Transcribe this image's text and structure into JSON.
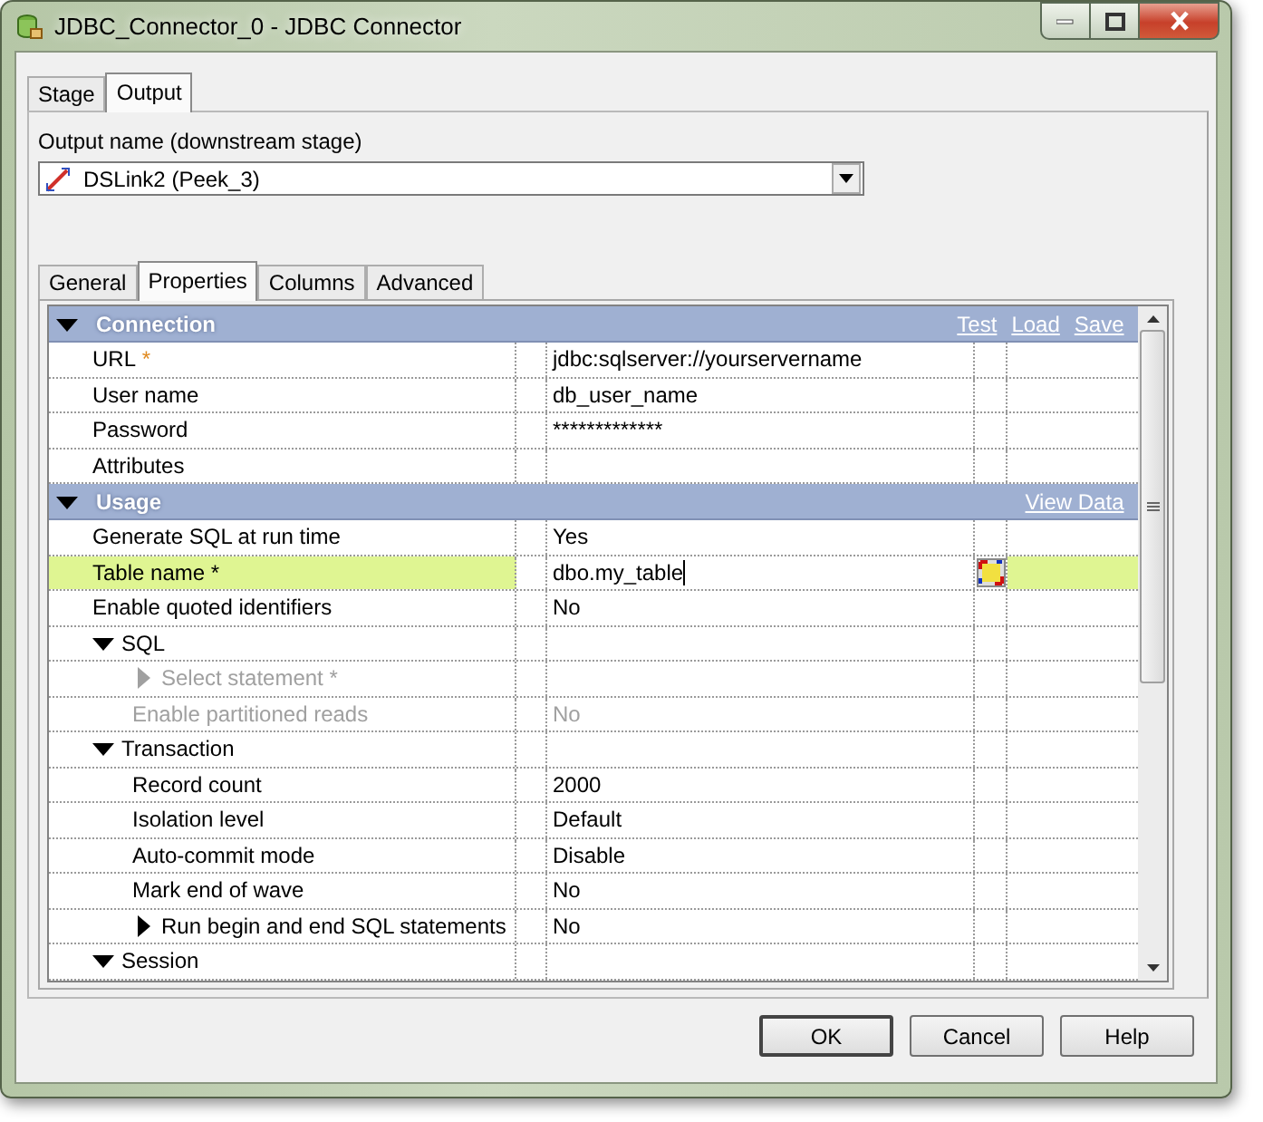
{
  "window": {
    "title": "JDBC_Connector_0 - JDBC Connector"
  },
  "stage_tabs": [
    {
      "label": "Stage",
      "selected": false
    },
    {
      "label": "Output",
      "selected": true
    }
  ],
  "output_name": {
    "label": "Output name (downstream stage)",
    "value": "DSLink2 (Peek_3)"
  },
  "property_tabs": [
    {
      "label": "General",
      "selected": false
    },
    {
      "label": "Properties",
      "selected": true
    },
    {
      "label": "Columns",
      "selected": false
    },
    {
      "label": "Advanced",
      "selected": false
    }
  ],
  "sections": [
    {
      "title": "Connection",
      "expanded": true,
      "links": [
        "Test",
        "Load",
        "Save"
      ],
      "children": [
        {
          "kind": "property",
          "name": "URL",
          "required": "*",
          "value": "jdbc:sqlserver://yourservername",
          "selected": false,
          "disabled": false
        },
        {
          "kind": "property",
          "name": "User name",
          "value": "db_user_name",
          "selected": false,
          "disabled": false
        },
        {
          "kind": "property",
          "name": "Password",
          "value": "*************",
          "selected": false,
          "disabled": false
        },
        {
          "kind": "property",
          "name": "Attributes",
          "selected": false,
          "disabled": false
        }
      ]
    },
    {
      "title": "Usage",
      "expanded": true,
      "links": [
        "View Data"
      ],
      "children": [
        {
          "kind": "property",
          "name": "Generate SQL at run time",
          "value": "Yes",
          "selected": false,
          "disabled": false
        },
        {
          "kind": "property",
          "name": "Table name",
          "required": "*",
          "value": "dbo.my_table",
          "selected": true,
          "disabled": false,
          "browse_button": true
        },
        {
          "kind": "property",
          "name": "Enable quoted identifiers",
          "value": "No",
          "selected": false,
          "disabled": false
        },
        {
          "kind": "group",
          "name": "SQL",
          "expanded": true,
          "children": [
            {
              "kind": "property",
              "name": "Select statement",
              "required": "*",
              "expanded": false,
              "selected": false,
              "disabled": true
            },
            {
              "kind": "property",
              "name": "Enable partitioned reads",
              "value": "No",
              "selected": false,
              "disabled": true
            }
          ]
        },
        {
          "kind": "group",
          "name": "Transaction",
          "expanded": true,
          "children": [
            {
              "kind": "property",
              "name": "Record count",
              "value": "2000",
              "selected": false,
              "disabled": false
            },
            {
              "kind": "property",
              "name": "Isolation level",
              "value": "Default",
              "selected": false,
              "disabled": false
            },
            {
              "kind": "property",
              "name": "Auto-commit mode",
              "value": "Disable",
              "selected": false,
              "disabled": false
            },
            {
              "kind": "property",
              "name": "Mark end of wave",
              "value": "No",
              "selected": false,
              "disabled": false
            },
            {
              "kind": "property",
              "name": "Run begin and end SQL statements",
              "expanded": false,
              "value": "No",
              "selected": false,
              "disabled": false
            }
          ]
        },
        {
          "kind": "group",
          "name": "Session",
          "expanded": true
        }
      ]
    }
  ],
  "buttons": [
    {
      "label": "OK"
    },
    {
      "label": "Cancel"
    },
    {
      "label": "Help"
    }
  ]
}
